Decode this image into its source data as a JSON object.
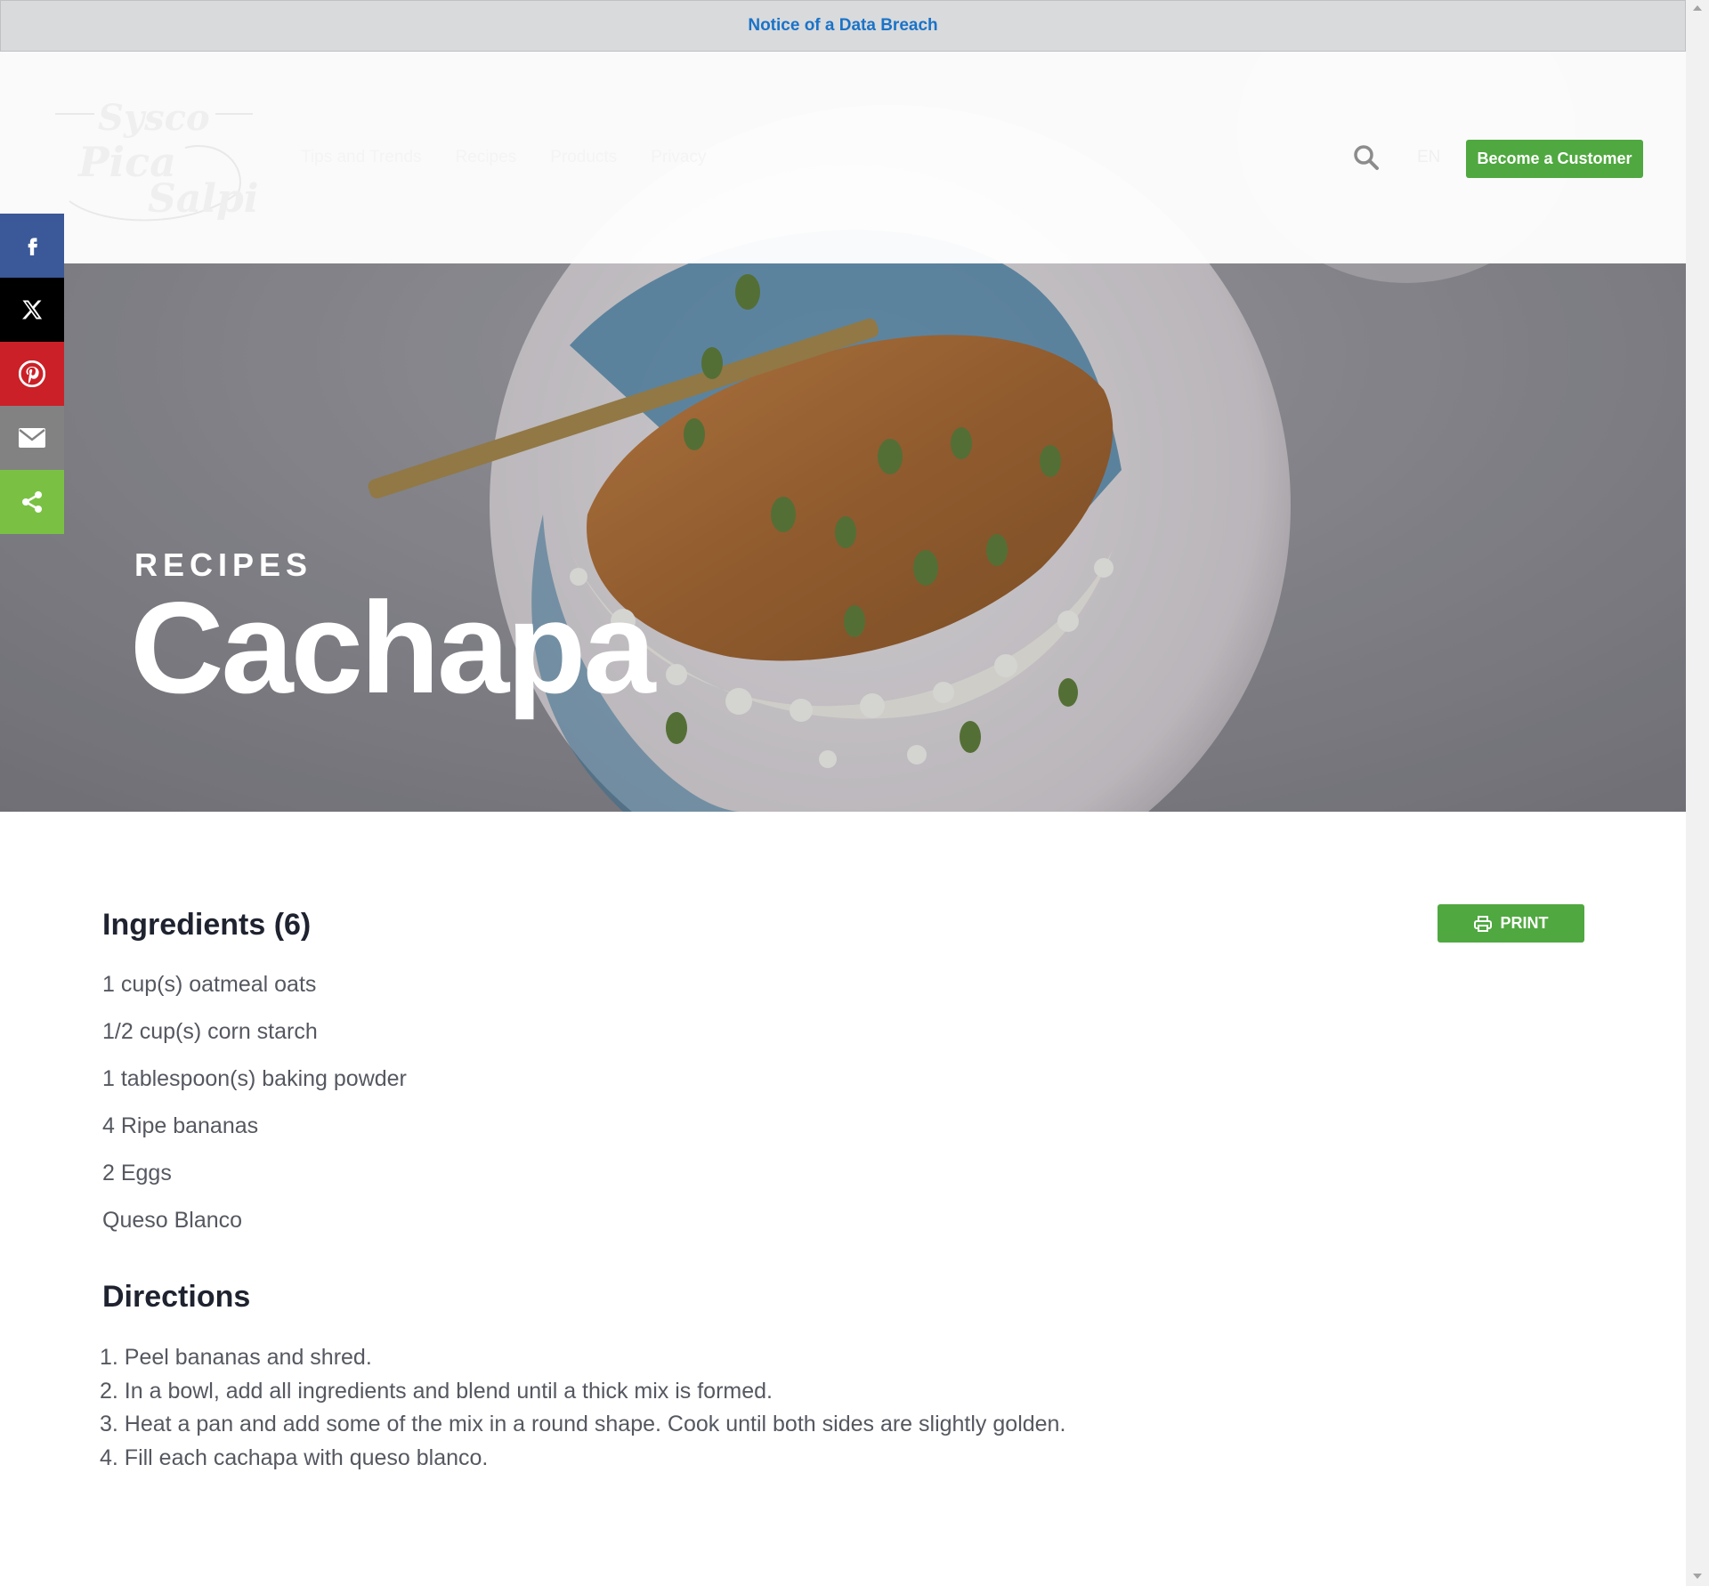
{
  "notice": {
    "label": "Notice of a Data Breach"
  },
  "header": {
    "logo_text": "Sysco Pica Salpica",
    "nav": [
      "Tips and Trends",
      "Recipes",
      "Products",
      "Privacy"
    ],
    "lang": "EN",
    "cta": "Become a Customer"
  },
  "hero": {
    "eyebrow": "RECIPES",
    "title": "Cachapa"
  },
  "share": [
    "facebook-icon",
    "x-icon",
    "pinterest-icon",
    "email-icon",
    "share-icon"
  ],
  "colors": {
    "accent": "#50a840",
    "facebook": "#3b5998",
    "pinterest": "#cb2027",
    "share": "#7ac143",
    "link": "#1a73c8"
  },
  "ingredients": {
    "heading": "Ingredients (6)",
    "print_label": "PRINT",
    "items": [
      "1 cup(s) oatmeal oats",
      "1/2 cup(s) corn starch",
      "1 tablespoon(s) baking powder",
      "4 Ripe bananas",
      "2 Eggs",
      "Queso Blanco"
    ]
  },
  "directions": {
    "heading": "Directions",
    "steps": [
      "1. Peel bananas and shred.",
      "2. In a bowl, add all ingredients and blend until a thick mix is formed.",
      "3. Heat a pan and add some of the mix in a round shape. Cook until both sides are slightly golden.",
      "4. Fill each cachapa with queso blanco."
    ]
  }
}
